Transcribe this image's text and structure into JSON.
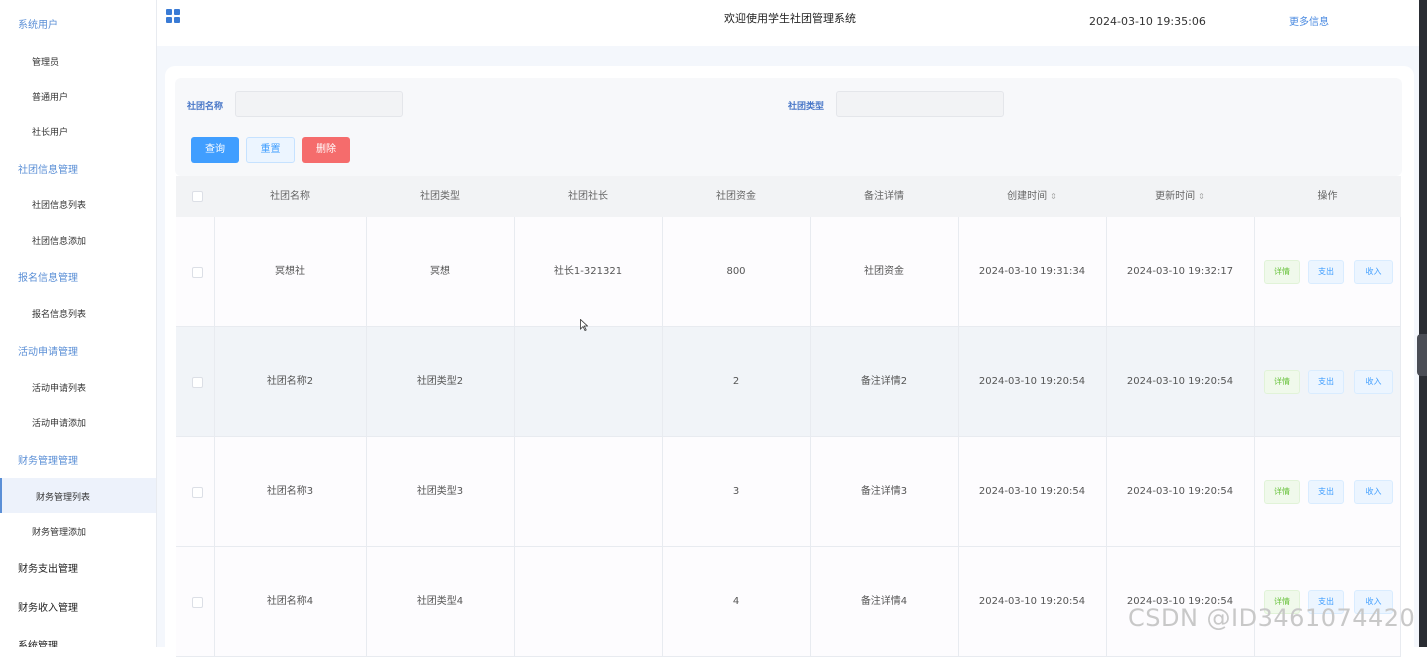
{
  "sidebar": {
    "groups": [
      {
        "label": "系统用户",
        "items": [
          "管理员",
          "普通用户",
          "社长用户"
        ]
      },
      {
        "label": "社团信息管理",
        "items": [
          "社团信息列表",
          "社团信息添加"
        ]
      },
      {
        "label": "报名信息管理",
        "items": [
          "报名信息列表"
        ]
      },
      {
        "label": "活动申请管理",
        "items": [
          "活动申请列表",
          "活动申请添加"
        ]
      },
      {
        "label": "财务管理管理",
        "items": [
          "财务管理列表",
          "财务管理添加"
        ]
      }
    ],
    "top_items": [
      "财务支出管理",
      "财务收入管理",
      "系统管理"
    ],
    "active_item": "财务管理列表"
  },
  "header": {
    "title": "欢迎使用学生社团管理系统",
    "datetime": "2024-03-10 19:35:06",
    "more_link": "更多信息"
  },
  "search": {
    "name_label": "社团名称",
    "type_label": "社团类型",
    "query_button": "查询",
    "reset_button": "重置",
    "delete_button": "删除"
  },
  "table": {
    "columns": [
      "社团名称",
      "社团类型",
      "社团社长",
      "社团资金",
      "备注详情",
      "创建时间",
      "更新时间",
      "操作"
    ],
    "rows": [
      {
        "name": "冥想社",
        "type": "冥想",
        "leader": "社长1-321321",
        "funds": "800",
        "note": "社团资金",
        "created": "2024-03-10 19:31:34",
        "updated": "2024-03-10 19:32:17"
      },
      {
        "name": "社团名称2",
        "type": "社团类型2",
        "leader": "",
        "funds": "2",
        "note": "备注详情2",
        "created": "2024-03-10 19:20:54",
        "updated": "2024-03-10 19:20:54"
      },
      {
        "name": "社团名称3",
        "type": "社团类型3",
        "leader": "",
        "funds": "3",
        "note": "备注详情3",
        "created": "2024-03-10 19:20:54",
        "updated": "2024-03-10 19:20:54"
      },
      {
        "name": "社团名称4",
        "type": "社团类型4",
        "leader": "",
        "funds": "4",
        "note": "备注详情4",
        "created": "2024-03-10 19:20:54",
        "updated": "2024-03-10 19:20:54"
      }
    ],
    "actions": {
      "detail": "详情",
      "expense": "支出",
      "income": "收入"
    }
  },
  "watermark": "CSDN @ID3461074420",
  "colors": {
    "primary": "#409eff",
    "danger": "#f56c6c",
    "success": "#67c23a",
    "sidebar_accent": "#5b8fd6"
  }
}
